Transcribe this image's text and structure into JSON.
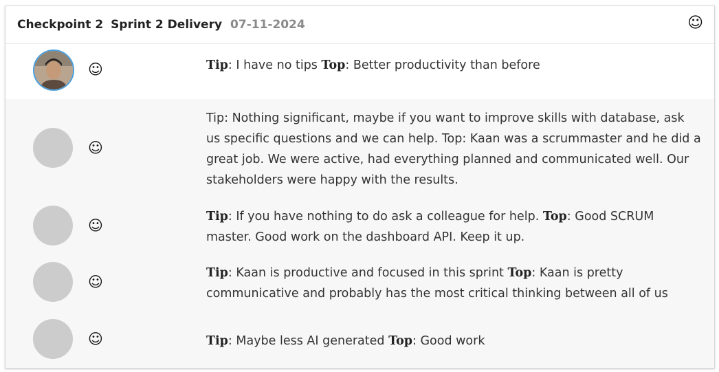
{
  "header": {
    "checkpoint": "Checkpoint 2",
    "sprint": "Sprint 2 Delivery",
    "date": "07-11-2024",
    "mood_icon": "smiley-icon"
  },
  "labels": {
    "tip": "Tip",
    "top": "Top"
  },
  "feedback": [
    {
      "tip_text": ": I have no tips ",
      "top_text": ": Better productivity than before",
      "avatar": "photo",
      "mood": "☺"
    },
    {
      "plain_text": "Tip: Nothing significant, maybe if you want to improve skills with database, ask us specific questions and we can help. Top: Kaan was a scrummaster and he did a great job. We were active, had everything planned and communicated well. Our stakeholders were happy with the results.",
      "avatar": "placeholder",
      "mood": "☺"
    },
    {
      "tip_text": ": If you have nothing to do ask a colleague for help. ",
      "top_text": ": Good SCRUM master. Good work on the dashboard API. Keep it up.",
      "avatar": "placeholder",
      "mood": "☺"
    },
    {
      "tip_text": ": Kaan is productive and focused in this sprint ",
      "top_text": ": Kaan is pretty communicative and probably has the most critical thinking between all of us",
      "avatar": "placeholder",
      "mood": "☺"
    },
    {
      "tip_text": ": Maybe less AI generated ",
      "top_text": ": Good work",
      "avatar": "placeholder",
      "mood": "☺"
    }
  ]
}
